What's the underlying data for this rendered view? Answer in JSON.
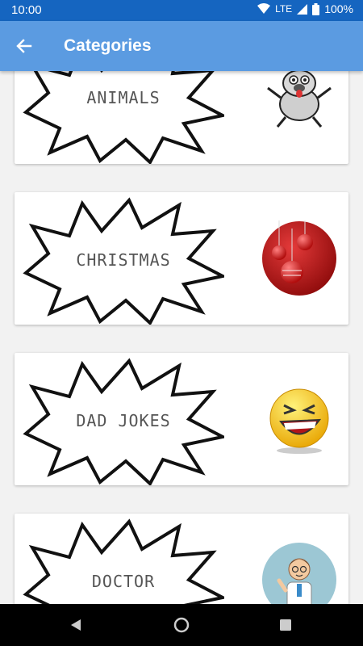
{
  "status": {
    "time": "10:00",
    "network": "LTE",
    "battery": "100%"
  },
  "appbar": {
    "title": "Categories",
    "back_icon": "arrow-back-icon"
  },
  "categories": [
    {
      "label": "ANIMALS",
      "thumbnail": "pug-dog-icon"
    },
    {
      "label": "CHRISTMAS",
      "thumbnail": "christmas-ornaments-icon"
    },
    {
      "label": "DAD JOKES",
      "thumbnail": "laughing-emoji-icon"
    },
    {
      "label": "DOCTOR",
      "thumbnail": "doctor-cartoon-icon"
    }
  ],
  "navbar": {
    "back": "nav-back-icon",
    "home": "nav-home-icon",
    "recents": "nav-recents-icon"
  },
  "colors": {
    "statusbar": "#1565c0",
    "appbar": "#5b9be1",
    "card": "#ffffff",
    "background": "#f2f2f2"
  }
}
